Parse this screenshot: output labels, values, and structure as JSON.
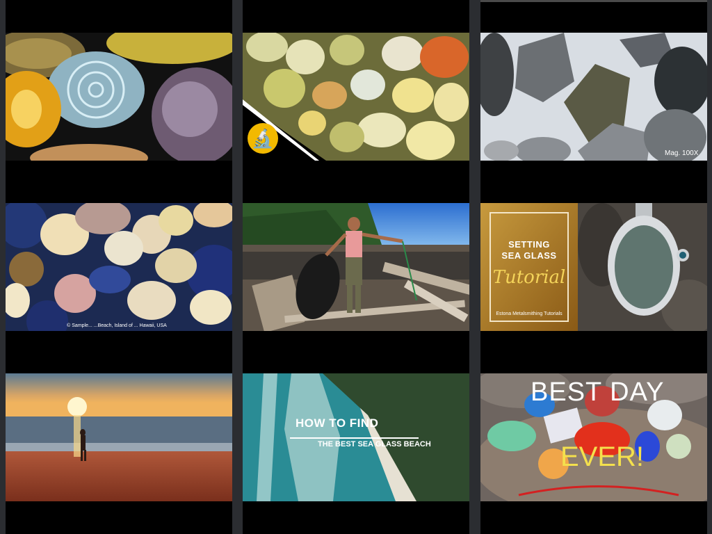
{
  "grid": {
    "thumbnails": [
      {
        "name": "sand-grains-macro-shells"
      },
      {
        "name": "sand-grains-microscope"
      },
      {
        "name": "sand-crystals-magnified",
        "caption": "Mag. 100X"
      },
      {
        "name": "sand-sample-hawaii",
        "caption": "© Sample... ...Beach, Island of ... Hawaii, USA"
      },
      {
        "name": "hiker-driftwood-beach"
      },
      {
        "name": "setting-sea-glass-tutorial",
        "title_line1": "SETTING",
        "title_line2": "SEA GLASS",
        "script_word": "Tutorial",
        "footer": "Estona Metalsmithing Tutorials"
      },
      {
        "name": "sunset-beach-walker"
      },
      {
        "name": "aerial-beach-sea-glass",
        "title_line1": "HOW TO FIND",
        "title_line2": "THE BEST SEA GLASS BEACH"
      },
      {
        "name": "best-day-ever-sea-glass",
        "title_line1": "BEST DAY",
        "title_line2": "EVER!"
      }
    ]
  },
  "colors": {
    "page_bg": "#2b2d31",
    "column_bg": "#000000",
    "tutorial_gold": "#b8872c",
    "microscope_badge": "#f2b900",
    "best_day_yellow": "#f4e04d"
  },
  "icons": {
    "microscope": "microscope-icon"
  }
}
